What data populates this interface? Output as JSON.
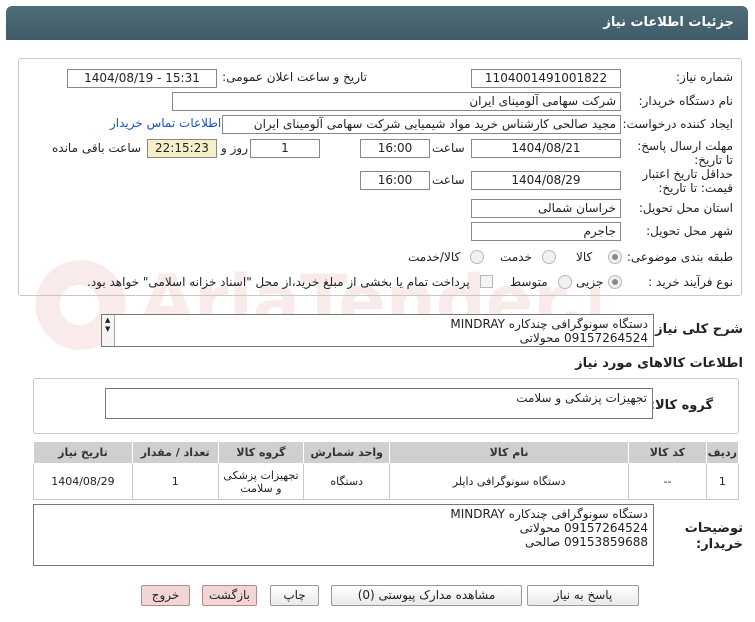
{
  "header": {
    "title": "جزئیات اطلاعات نیاز"
  },
  "watermark": {
    "text": "AriaTender.net"
  },
  "form": {
    "need_number_label": "شماره نیاز:",
    "need_number": "1104001491001822",
    "announce_label": "تاریخ و ساعت اعلان عمومی:",
    "announce_value": "1404/08/19 - 15:31",
    "buyer_label": "نام دستگاه خریدار:",
    "buyer_value": "شرکت سهامی آلومینای ایران",
    "requester_label": "ایجاد کننده درخواست:",
    "requester_value": "مجید صالحی کارشناس خرید مواد شیمیایی شرکت سهامی آلومینای ایران",
    "contact_link": "اطلاعات تماس خریدار",
    "deadline_label": "مهلت ارسال پاسخ: تا تاریخ:",
    "deadline_date": "1404/08/21",
    "time_label": "ساعت",
    "deadline_time": "16:00",
    "days_value": "1",
    "days_label": "روز و",
    "remaining_time": "22:15:23",
    "remaining_label": "ساعت باقی مانده",
    "validity_label": "حداقل تاریخ اعتبار قیمت: تا تاریخ:",
    "validity_date": "1404/08/29",
    "validity_time_label": "ساعت",
    "validity_time": "16:00",
    "province_label": "استان محل تحویل:",
    "province_value": "خراسان شمالی",
    "city_label": "شهر محل تحویل:",
    "city_value": "جاجرم",
    "category_label": "طبقه بندی موضوعی:",
    "category_options": [
      "کالا",
      "خدمت",
      "کالا/خدمت"
    ],
    "process_label": "نوع فرآیند خرید :",
    "process_options": [
      "جزیی",
      "متوسط"
    ],
    "payment_text": "پرداخت تمام یا بخشی از مبلغ خرید،از محل \"اسناد خزانه اسلامی\" خواهد بود."
  },
  "summary": {
    "label": "شرح کلی نیاز:",
    "text": "دستگاه سونوگرافی چندکاره MINDRAY\n09157264524 محولاتی"
  },
  "goods_info": {
    "title": "اطلاعات کالاهای مورد نیاز",
    "group_label": "گروه کالا:",
    "group_value": "تجهیزات پزشکی و سلامت"
  },
  "table": {
    "headers": [
      "ردیف",
      "کد کالا",
      "نام کالا",
      "واحد شمارش",
      "گروه کالا",
      "تعداد / مقدار",
      "تاریخ نیاز"
    ],
    "rows": [
      [
        "1",
        "--",
        "دستگاه سونوگرافی داپلر",
        "دستگاه",
        "تجهیزات پزشکی و سلامت",
        "1",
        "1404/08/29"
      ]
    ]
  },
  "buyer_notes": {
    "label": "توضیحات خریدار:",
    "text": "دستگاه سونوگرافی چندکاره MINDRAY\n09157264524 محولاتی\n09153859688 صالحی"
  },
  "buttons": {
    "reply": "پاسخ به نیاز",
    "docs": "مشاهده مدارک پیوستی (0)",
    "print": "چاپ",
    "back": "بازگشت",
    "exit": "خروج"
  }
}
